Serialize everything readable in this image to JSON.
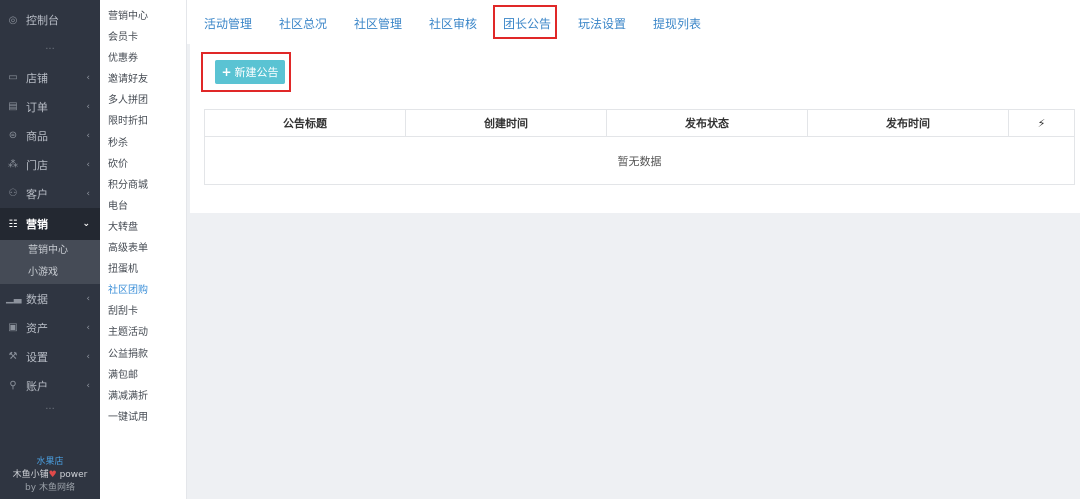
{
  "sidebar": {
    "top": {
      "label": "控制台",
      "icon": "dashboard-icon"
    },
    "dots": "···",
    "items": [
      {
        "label": "店铺",
        "icon": "store-icon"
      },
      {
        "label": "订单",
        "icon": "order-icon"
      },
      {
        "label": "商品",
        "icon": "goods-icon"
      },
      {
        "label": "门店",
        "icon": "branch-icon"
      },
      {
        "label": "客户",
        "icon": "customer-icon"
      }
    ],
    "active": {
      "label": "营销",
      "icon": "marketing-icon"
    },
    "sub": [
      "营销中心",
      "小游戏"
    ],
    "items2": [
      {
        "label": "数据",
        "icon": "data-icon"
      },
      {
        "label": "资产",
        "icon": "asset-icon"
      },
      {
        "label": "设置",
        "icon": "settings-icon"
      },
      {
        "label": "账户",
        "icon": "account-icon"
      }
    ],
    "dots2": "···",
    "footer": {
      "line1": "水果店",
      "line2a": "木鱼小铺",
      "line2b": "power",
      "line3": "by 木鱼网络"
    }
  },
  "menu2": [
    "营销中心",
    "会员卡",
    "优惠券",
    "邀请好友",
    "多人拼团",
    "限时折扣",
    "秒杀",
    "砍价",
    "积分商城",
    "电台",
    "大转盘",
    "高级表单",
    "扭蛋机",
    "社区团购",
    "刮刮卡",
    "主题活动",
    "公益捐款",
    "满包邮",
    "满减满折",
    "一键试用"
  ],
  "menu2_active": "社区团购",
  "tabs": [
    "活动管理",
    "社区总况",
    "社区管理",
    "社区审核",
    "团长公告",
    "玩法设置",
    "提现列表"
  ],
  "active_tab": "团长公告",
  "add_button": {
    "plus": "+",
    "label": "新建公告"
  },
  "table": {
    "headers": [
      "公告标题",
      "创建时间",
      "发布状态",
      "发布时间",
      "⚡"
    ],
    "empty": "暂无数据"
  },
  "colors": {
    "accent": "#3b86c8",
    "button": "#5ac3d3",
    "highlight": "#e02828",
    "sidebar": "#2f3541"
  }
}
